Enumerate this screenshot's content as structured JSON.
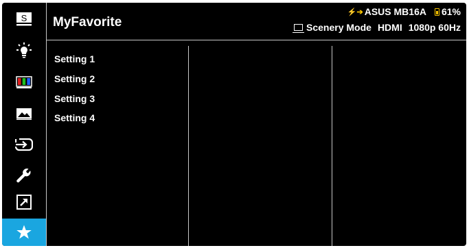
{
  "header": {
    "title": "MyFavorite",
    "model": "ASUS MB16A",
    "battery": "61%",
    "mode": "Scenery Mode",
    "input": "HDMI",
    "resolution": "1080p 60Hz"
  },
  "sidebar": {
    "items": [
      {
        "icon": "splendid-icon"
      },
      {
        "icon": "blue-light-filter-icon"
      },
      {
        "icon": "color-icon"
      },
      {
        "icon": "image-icon"
      },
      {
        "icon": "input-select-icon"
      },
      {
        "icon": "system-setup-icon"
      },
      {
        "icon": "shortcut-icon"
      },
      {
        "icon": "star-icon",
        "active": true
      }
    ]
  },
  "menu": {
    "items": [
      "Setting 1",
      "Setting 2",
      "Setting 3",
      "Setting 4"
    ]
  },
  "colors": {
    "background": "#000000",
    "active": "#1aa6e0",
    "divider": "#c8c8c8",
    "battery": "#f7c300"
  }
}
